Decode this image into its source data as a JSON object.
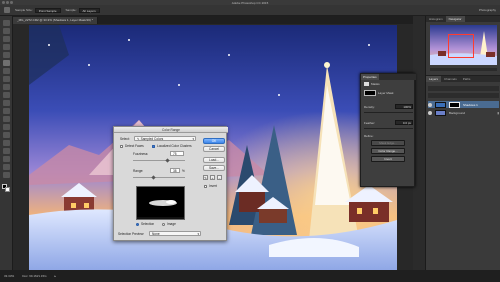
{
  "window": {
    "title": "Adobe Photoshop CC 2015"
  },
  "options_bar": {
    "tool_label": "Sample Size:",
    "sample_size": "Point Sample",
    "sample_label": "Sample:",
    "sample_value": "All Layers",
    "workspace": "Photography"
  },
  "document": {
    "tab_title": "_MG_2272.CR2 @ 33.3% (Shadows 1, Layer Mask/16) *"
  },
  "status": {
    "zoom": "33.33%",
    "doc_info": "Doc: 69.1M/1.15G"
  },
  "right_panel": {
    "tabs": [
      "Histogram",
      "Navigator"
    ],
    "active_tab": "Navigator",
    "layers_tabs": [
      "Layers",
      "Channels",
      "Paths"
    ],
    "layers": [
      {
        "name": "Shadows 1",
        "selected": true,
        "has_mask": true
      },
      {
        "name": "Background",
        "selected": false,
        "has_mask": false
      }
    ]
  },
  "properties": {
    "tabs": [
      "Properties"
    ],
    "title": "Masks",
    "mask_type": "Layer Mask",
    "density_label": "Density:",
    "density_value": "100%",
    "feather_label": "Feather:",
    "feather_value": "0.0 px",
    "refine_label": "Refine:",
    "mask_edge": "Mask Edge...",
    "color_range": "Color Range...",
    "invert": "Invert"
  },
  "color_range": {
    "title": "Color Range",
    "select_label": "Select:",
    "select_value": "Sampled Colors",
    "detect_faces": "Detect Faces",
    "localized": "Localized Color Clusters",
    "fuzziness_label": "Fuzziness:",
    "fuzziness_value": "75",
    "range_label": "Range:",
    "range_value": "38",
    "range_unit": "%",
    "selection_label": "Selection",
    "image_label": "Image",
    "preview_label": "Selection Preview:",
    "preview_value": "None",
    "buttons": {
      "ok": "OK",
      "cancel": "Cancel",
      "load": "Load...",
      "save": "Save..."
    },
    "invert": "Invert"
  },
  "colors": {
    "accent": "#3a7bd5",
    "navigator_box": "#ff3b2f"
  }
}
